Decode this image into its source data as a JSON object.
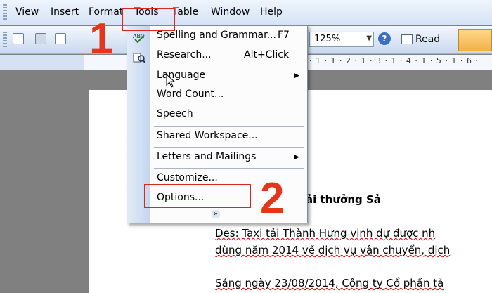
{
  "menubar": {
    "items": [
      "View",
      "Insert",
      "Format",
      "Tools",
      "Table",
      "Window",
      "Help"
    ]
  },
  "toolbar": {
    "zoom": "125%",
    "read_label": "Read"
  },
  "ruler": {
    "marks": "· 1 · 1 · 2 · 1 · 3 · 1 · 4 · 1 · 5 · 1 · 6 ·"
  },
  "tools_menu": {
    "items": [
      {
        "label": "Spelling and Grammar...",
        "shortcut": "F7"
      },
      {
        "label": "Research...",
        "shortcut": "Alt+Click"
      },
      {
        "label": "Language",
        "submenu": "▶"
      },
      {
        "label": "Word Count..."
      },
      {
        "label": "Speech"
      },
      {
        "label": "Shared Workspace..."
      },
      {
        "label": "Letters and Mailings",
        "submenu": "▶"
      },
      {
        "label": "Customize..."
      },
      {
        "label": "Options..."
      }
    ],
    "expand": "»"
  },
  "document": {
    "title": "h Hưng nhận giải thưởng Sả",
    "line1": "Des: Taxi tải Thành Hưng vinh dự được nh",
    "line2": "dùng năm 2014 về dịch vụ vận chuyển, dịch",
    "line3": "Sáng ngày 23/08/2014, Công ty Cổ phần tả"
  },
  "annotations": {
    "step1": "1",
    "step2": "2"
  },
  "colors": {
    "highlight": "#e0251b",
    "menu_gutter": "#c4d6ee"
  }
}
